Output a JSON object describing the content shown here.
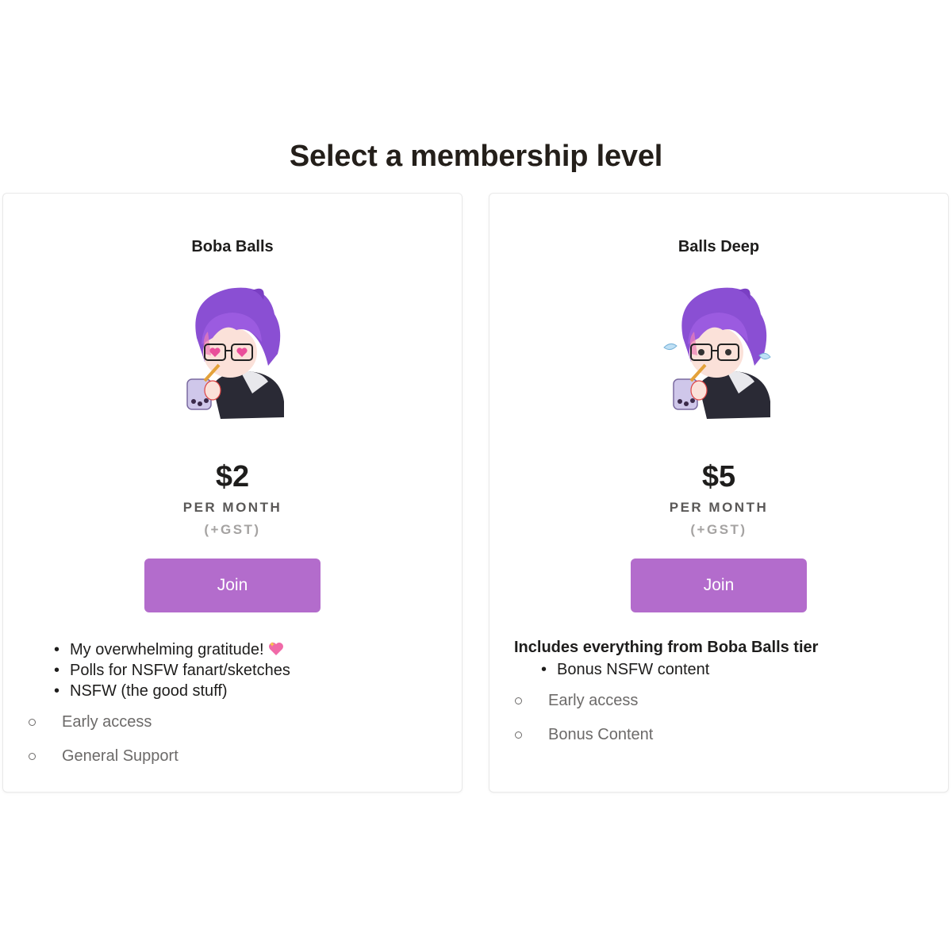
{
  "page": {
    "title": "Select a membership level"
  },
  "tiers": [
    {
      "name": "Boba Balls",
      "price": "$2",
      "period": "PER MONTH",
      "tax": "(+GST)",
      "join_label": "Join",
      "benefits": [
        "My overwhelming gratitude!",
        "Polls for NSFW fanart/sketches",
        "NSFW (the good stuff)"
      ],
      "sub_benefits": [
        "Early access",
        "General Support"
      ],
      "art_icon": "anime-character-drinking-boba-heart-eyes"
    },
    {
      "name": "Balls Deep",
      "price": "$5",
      "period": "PER MONTH",
      "tax": "(+GST)",
      "join_label": "Join",
      "includes": "Includes everything from Boba Balls tier",
      "benefits": [
        "Bonus NSFW content"
      ],
      "sub_benefits": [
        "Early access",
        "Bonus Content"
      ],
      "art_icon": "anime-character-drinking-boba-flustered"
    }
  ],
  "colors": {
    "accent": "#b36ccc",
    "heading": "#241f1a",
    "muted": "#6c6a69",
    "faint": "#a5a3a2"
  }
}
